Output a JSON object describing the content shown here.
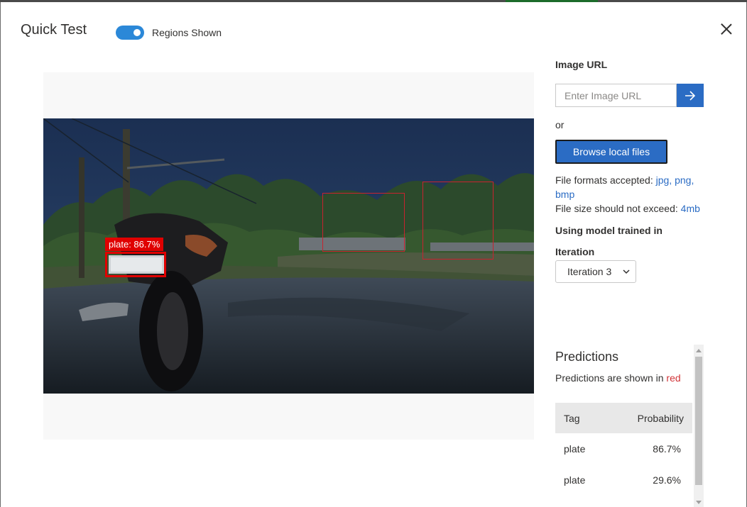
{
  "header": {
    "title": "Quick Test",
    "toggle_label": "Regions Shown",
    "toggle_on": true
  },
  "image": {
    "regions": [
      {
        "label": "plate: 86.7%",
        "selected": true
      },
      {
        "label": "",
        "selected": false
      },
      {
        "label": "",
        "selected": false
      }
    ]
  },
  "panel": {
    "image_url_label": "Image URL",
    "image_url_placeholder": "Enter Image URL",
    "image_url_value": "",
    "or_text": "or",
    "browse_label": "Browse local files",
    "formats_prefix": "File formats accepted: ",
    "formats_value": "jpg, png, bmp",
    "size_prefix": "File size should not exceed: ",
    "size_value": "4mb",
    "model_label": "Using model trained in",
    "iteration_label": "Iteration",
    "iteration_selected": "Iteration 3"
  },
  "predictions": {
    "title": "Predictions",
    "subtitle_prefix": "Predictions are shown in ",
    "subtitle_color_word": "red",
    "columns": [
      "Tag",
      "Probability"
    ],
    "rows": [
      {
        "tag": "plate",
        "probability": "86.7%"
      },
      {
        "tag": "plate",
        "probability": "29.6%"
      }
    ]
  },
  "colors": {
    "accent": "#2b6cc4",
    "toggle": "#2b88d8",
    "region": "#e00000"
  }
}
